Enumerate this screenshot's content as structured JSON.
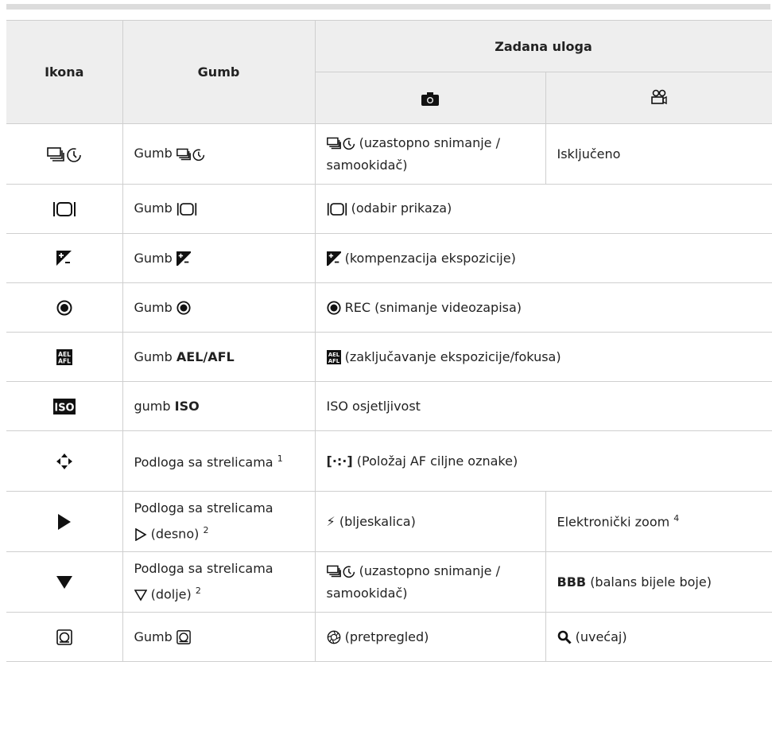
{
  "header": {
    "col_icon": "Ikona",
    "col_button": "Gumb",
    "col_default": "Zadana uloga"
  },
  "rows": [
    {
      "button": "Gumb",
      "photo": "(uzastopno snimanje / samookidač)",
      "video": "Isključeno"
    },
    {
      "button": "Gumb",
      "both": "(odabir prikaza)"
    },
    {
      "button": "Gumb",
      "both": "(kompenzacija ekspozicije)"
    },
    {
      "button": "Gumb",
      "both": "REC (snimanje videozapisa)"
    },
    {
      "button": "Gumb",
      "button_bold": "AEL/AFL",
      "both": "(zaključavanje ekspozicije/fokusa)"
    },
    {
      "button": "gumb",
      "button_bold": "ISO",
      "both": "ISO osjetljivost"
    },
    {
      "button": "Podloga sa strelicama",
      "sup": "1",
      "both_glyph": "[·:·]",
      "both": "(Položaj AF ciljne oznake)"
    },
    {
      "button": "Podloga sa strelicama",
      "button2": "(desno)",
      "sup": "2",
      "photo": "(bljeskalica)",
      "video": "Elektronički zoom",
      "video_sup": "4"
    },
    {
      "button": "Podloga sa strelicama",
      "button2": "(dolje)",
      "sup": "2",
      "photo": "(uzastopno snimanje / samookidač)",
      "video_bold": "BBB",
      "video": "(balans bijele boje)"
    },
    {
      "button": "Gumb",
      "photo": "(pretpregled)",
      "video": "(uvećaj)"
    }
  ]
}
